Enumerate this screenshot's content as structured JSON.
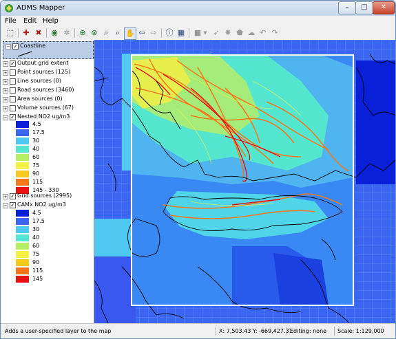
{
  "window": {
    "title": "ADMS Mapper",
    "minimize": "–",
    "maximize": "□",
    "close": "✕"
  },
  "menu": [
    "File",
    "Edit",
    "Help"
  ],
  "toolbar": {
    "icons": [
      "open-layer-icon",
      "add-layer-icon",
      "remove-layer-icon",
      "globe-icon",
      "settings-icon",
      "zoom-extent-icon",
      "zoom-layer-icon",
      "zoom-in-icon",
      "zoom-out-icon",
      "pan-hand-icon",
      "back-arrow-icon",
      "forward-arrow-icon",
      "info-icon",
      "table-icon",
      "stop-icon",
      "dropdown-icon",
      "pointer-icon",
      "star-icon",
      "shape-icon",
      "cloud-icon",
      "undo-icon",
      "redo-icon"
    ]
  },
  "legend": {
    "coastline": "Coastline",
    "layers": [
      {
        "label": "Output grid extent",
        "checked": true
      },
      {
        "label": "Point sources (125)",
        "checked": false
      },
      {
        "label": "Line sources (0)",
        "checked": false
      },
      {
        "label": "Road sources (3460)",
        "checked": false
      },
      {
        "label": "Area sources (0)",
        "checked": false
      },
      {
        "label": "Volume sources (67)",
        "checked": false
      },
      {
        "label": "Nested NO2 ug/m3",
        "checked": true
      }
    ],
    "nested_scale": [
      {
        "label": "4.5",
        "color": "#0a1fd8"
      },
      {
        "label": "17.5",
        "color": "#3a66f2"
      },
      {
        "label": "30",
        "color": "#4fc8f2"
      },
      {
        "label": "40",
        "color": "#55e6d0"
      },
      {
        "label": "60",
        "color": "#b6ef66"
      },
      {
        "label": "75",
        "color": "#f2f04a"
      },
      {
        "label": "90",
        "color": "#f7c81e"
      },
      {
        "label": "115",
        "color": "#f7781a"
      },
      {
        "label": "145 - 330",
        "color": "#e81010"
      }
    ],
    "grid_layer": {
      "label": "Grid sources (2995)",
      "checked": true
    },
    "camx_layer": {
      "label": "CAMx NO2 ug/m3",
      "checked": true
    },
    "camx_scale": [
      {
        "label": "4.5",
        "color": "#0a1fd8"
      },
      {
        "label": "17.5",
        "color": "#3a66f2"
      },
      {
        "label": "30",
        "color": "#4fc8f2"
      },
      {
        "label": "40",
        "color": "#55e6d0"
      },
      {
        "label": "60",
        "color": "#b6ef66"
      },
      {
        "label": "75",
        "color": "#f2f04a"
      },
      {
        "label": "90",
        "color": "#f7c81e"
      },
      {
        "label": "115",
        "color": "#f7781a"
      },
      {
        "label": "145",
        "color": "#e81010"
      }
    ]
  },
  "status": {
    "message": "Adds a user-specified layer to the map",
    "coords": "X: 7,503.43  Y: -669,427.31",
    "editing": "Editing: none",
    "scale": "Scale: 1:129,000"
  }
}
